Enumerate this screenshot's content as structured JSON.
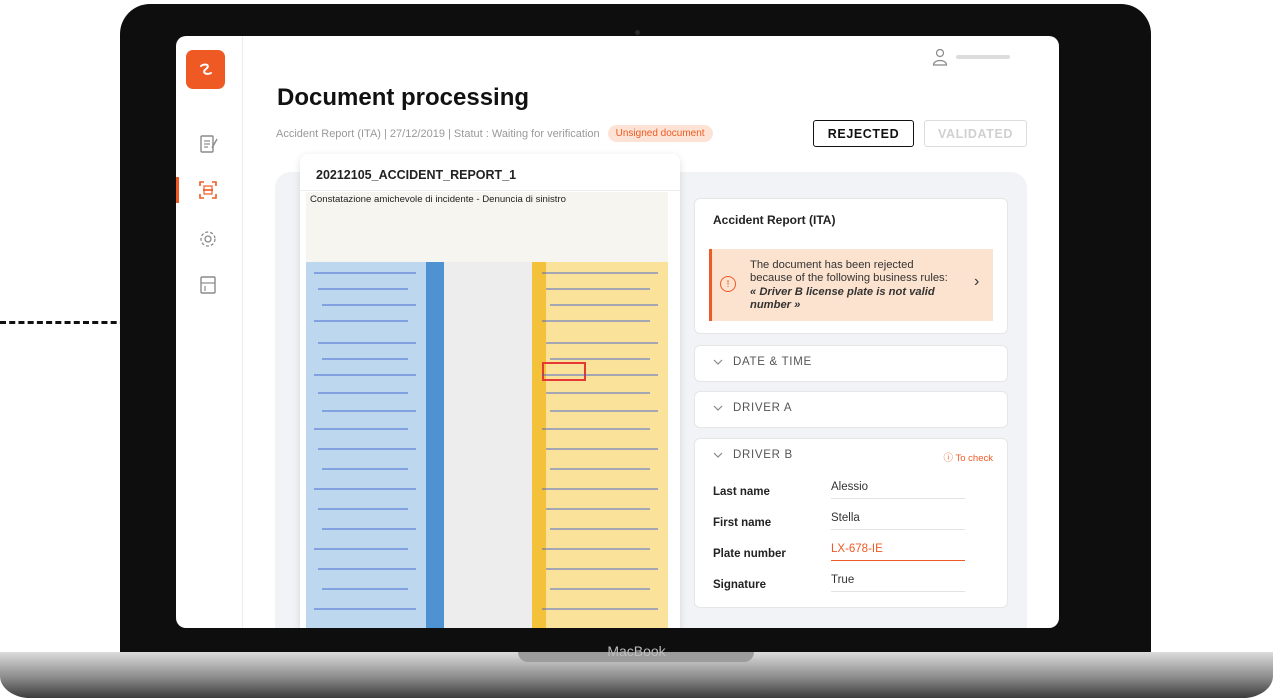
{
  "page": {
    "title": "Document processing",
    "breadcrumb": "Accident Report (ITA) | 27/12/2019 | Statut : Waiting for verification",
    "status_badge": "Unsigned document"
  },
  "actions": {
    "rejected_label": "REJECTED",
    "validated_label": "VALIDATED"
  },
  "sidebar": {
    "items": [
      {
        "icon": "documents-icon",
        "active": false
      },
      {
        "icon": "scan-icon",
        "active": true
      },
      {
        "icon": "settings-icon",
        "active": false
      },
      {
        "icon": "template-icon",
        "active": false
      }
    ]
  },
  "document": {
    "name": "20212105_ACCIDENT_REPORT_1",
    "scan_heading": "Constatazione amichevole di incidente - Denuncia di sinistro",
    "highlighted_plate": "LX-678-IE"
  },
  "report": {
    "title": "Accident Report (ITA)",
    "alert_prefix": "The document has been rejected because of the following business rules: ",
    "alert_rule": "« Driver B license plate is not valid number »"
  },
  "sections": {
    "date_time": "DATE & TIME",
    "driver_a": "DRIVER A",
    "driver_b": "DRIVER B",
    "to_check": "To check"
  },
  "driver_b": {
    "fields": [
      {
        "label": "Last name",
        "value": "Alessio",
        "warning": false
      },
      {
        "label": "First name",
        "value": "Stella",
        "warning": false
      },
      {
        "label": "Plate number",
        "value": "LX-678-IE",
        "warning": true
      },
      {
        "label": "Signature",
        "value": "True",
        "warning": false
      }
    ]
  },
  "device": {
    "brand": "MacBook"
  },
  "colors": {
    "accent": "#ef5a24",
    "alert_bg": "#fce3d0"
  }
}
